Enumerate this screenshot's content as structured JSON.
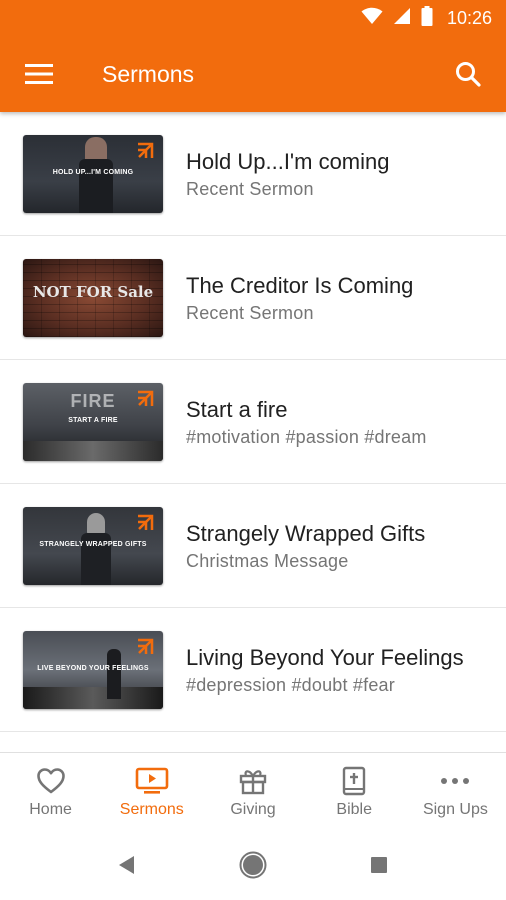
{
  "status": {
    "time": "10:26"
  },
  "app_bar": {
    "title": "Sermons"
  },
  "sermons": [
    {
      "title": "Hold Up...I'm coming",
      "subtitle": "Recent Sermon",
      "thumb_text": "HOLD UP...I'M COMING"
    },
    {
      "title": "The Creditor Is Coming",
      "subtitle": "Recent Sermon",
      "thumb_text": "NOT FOR Sale"
    },
    {
      "title": "Start a fire",
      "subtitle": "#motivation #passion #dream",
      "thumb_text": "START A FIRE",
      "thumb_big": "FIRE"
    },
    {
      "title": "Strangely Wrapped Gifts",
      "subtitle": "Christmas Message",
      "thumb_text": "STRANGELY WRAPPED GIFTS"
    },
    {
      "title": "Living Beyond Your Feelings",
      "subtitle": "#depression #doubt #fear",
      "thumb_text": "LIVE BEYOND YOUR FEELINGS"
    }
  ],
  "bottom_nav": [
    {
      "label": "Home",
      "icon": "heart-icon"
    },
    {
      "label": "Sermons",
      "icon": "tv-play-icon",
      "active": true
    },
    {
      "label": "Giving",
      "icon": "gift-icon"
    },
    {
      "label": "Bible",
      "icon": "bible-icon"
    },
    {
      "label": "Sign Ups",
      "icon": "more-dots-icon"
    }
  ],
  "colors": {
    "accent": "#f26c0d",
    "text": "#212121",
    "muted": "#757575"
  }
}
